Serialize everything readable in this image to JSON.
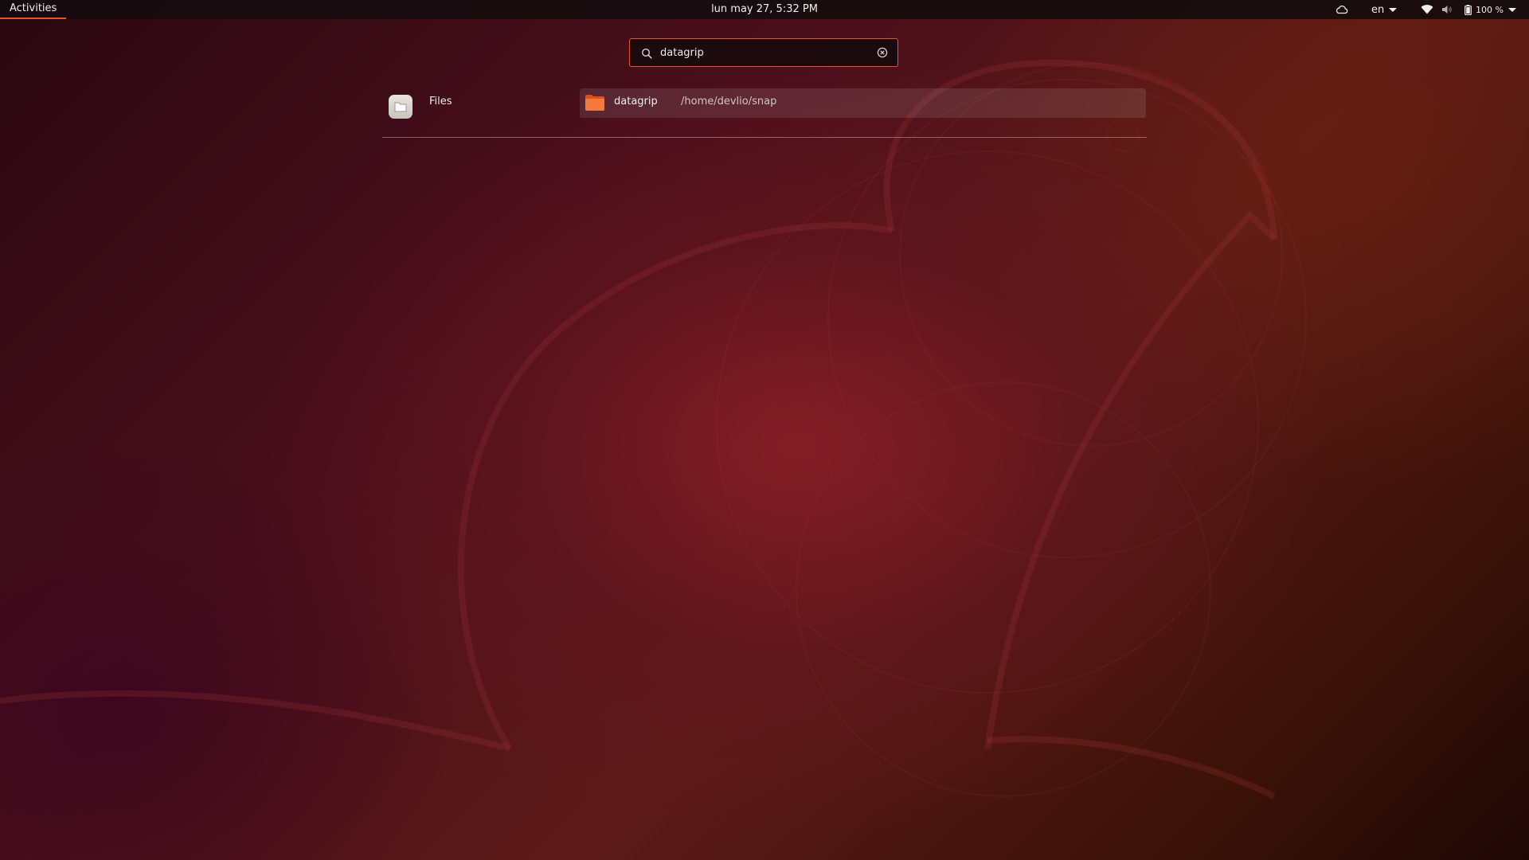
{
  "top_bar": {
    "activities_label": "Activities",
    "clock": "lun may 27,  5:32 PM",
    "tray": {
      "cloud_icon": "cloud-icon",
      "language": "en",
      "wifi_icon": "wifi-icon",
      "volume_icon": "volume-icon",
      "battery_icon": "battery-icon",
      "battery_percent": "100 %"
    }
  },
  "search": {
    "query": "datagrip",
    "search_icon": "search-icon",
    "clear_icon": "clear-icon"
  },
  "results": {
    "provider": {
      "label": "Files",
      "icon": "files-app-icon"
    },
    "items": [
      {
        "name": "datagrip",
        "path": "/home/devlio/snap",
        "icon": "folder-icon"
      }
    ]
  },
  "colors": {
    "accent": "#e95420",
    "folder": "#f26b2d",
    "top_bar": "#140c0e"
  }
}
